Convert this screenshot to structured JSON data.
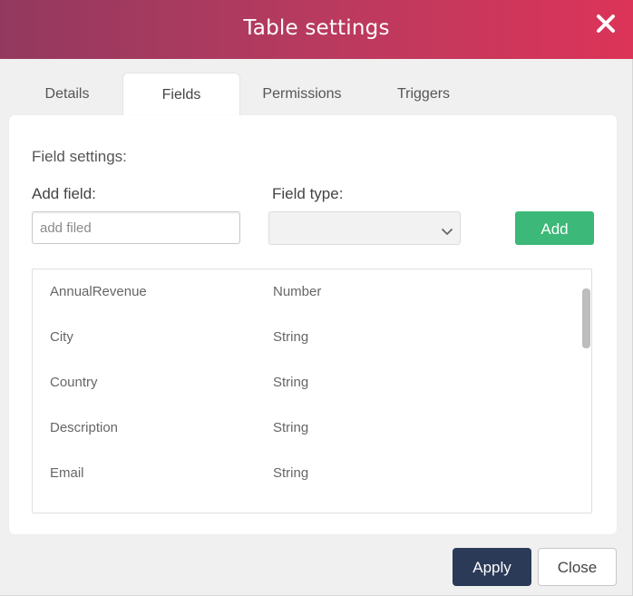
{
  "dialog": {
    "title": "Table settings"
  },
  "tabs": [
    {
      "label": "Details",
      "active": false
    },
    {
      "label": "Fields",
      "active": true
    },
    {
      "label": "Permissions",
      "active": false
    },
    {
      "label": "Triggers",
      "active": false
    }
  ],
  "fields_panel": {
    "section_title": "Field settings:",
    "add_field_label": "Add field:",
    "add_field_placeholder": "add filed",
    "add_field_value": "",
    "field_type_label": "Field type:",
    "field_type_selected": "",
    "add_button_label": "Add",
    "fields": [
      {
        "name": "AnnualRevenue",
        "type": "Number"
      },
      {
        "name": "City",
        "type": "String"
      },
      {
        "name": "Country",
        "type": "String"
      },
      {
        "name": "Description",
        "type": "String"
      },
      {
        "name": "Email",
        "type": "String"
      }
    ]
  },
  "footer": {
    "apply_label": "Apply",
    "close_label": "Close"
  },
  "colors": {
    "header_gradient_start": "#93395f",
    "header_gradient_end": "#dc3458",
    "add_button": "#3cb878",
    "apply_button": "#2b3a57"
  },
  "icons": {
    "close": "close-icon",
    "dropdown": "chevron-down-icon"
  }
}
